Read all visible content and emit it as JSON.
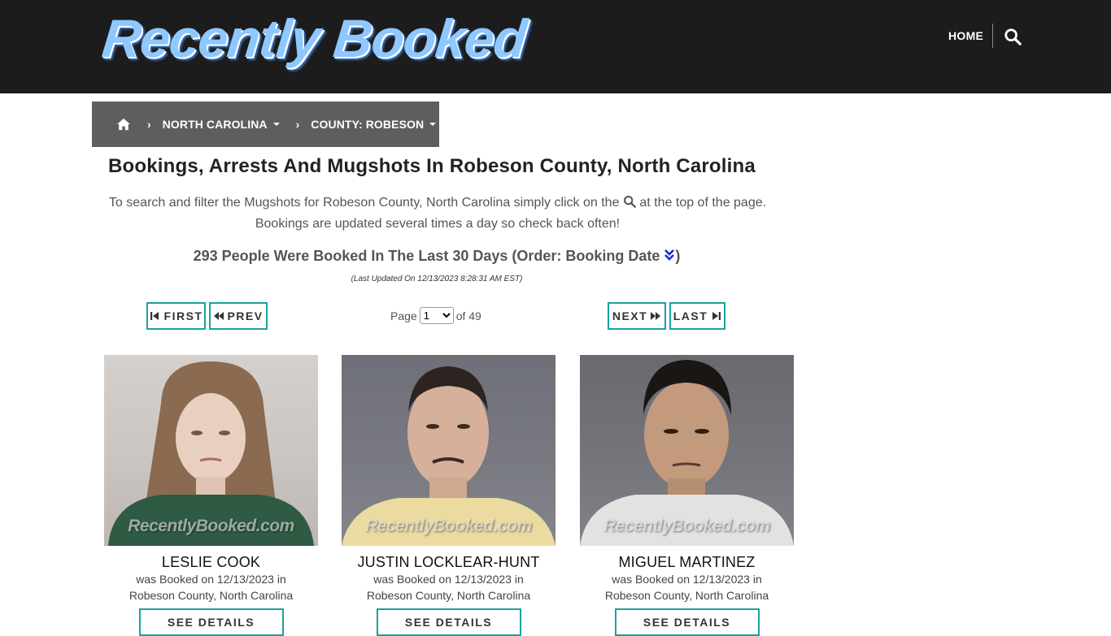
{
  "header": {
    "logo_text": "Recently Booked",
    "nav_home": "HOME",
    "search_icon": "search-icon"
  },
  "breadcrumb": {
    "home_icon": "home-icon",
    "state": "NORTH CAROLINA",
    "county": "COUNTY: ROBESON"
  },
  "main": {
    "title": "Bookings, Arrests And Mugshots In Robeson County, North Carolina",
    "intro_before": "To search and filter the Mugshots for Robeson County, North Carolina simply click on the",
    "intro_after": "at the top of the page. Bookings are updated several times a day so check back often!",
    "count_text": "293 People Were Booked In The Last 30 Days (Order: Booking Date",
    "count_close": ")",
    "last_updated": "(Last Updated On 12/13/2023 8:28:31 AM EST)"
  },
  "pagination": {
    "first": "FIRST",
    "prev": "PREV",
    "page_label": "Page",
    "current_page": "1",
    "of_label": "of 49",
    "next": "NEXT",
    "last": "LAST"
  },
  "bookings": [
    {
      "name": "LESLIE COOK",
      "line1": "was Booked on 12/13/2023 in",
      "line2": "Robeson County, North Carolina",
      "watermark": "RecentlyBooked.com",
      "details": "SEE DETAILS"
    },
    {
      "name": "JUSTIN LOCKLEAR-HUNT",
      "line1": "was Booked on 12/13/2023 in",
      "line2": "Robeson County, North Carolina",
      "watermark": "RecentlyBooked.com",
      "details": "SEE DETAILS"
    },
    {
      "name": "MIGUEL MARTINEZ",
      "line1": "was Booked on 12/13/2023 in",
      "line2": "Robeson County, North Carolina",
      "watermark": "RecentlyBooked.com",
      "details": "SEE DETAILS"
    }
  ],
  "colors": {
    "header_bg": "#1c1c1c",
    "breadcrumb_bg": "#5e5e5e",
    "accent": "#18a39d",
    "order_icon": "#1a2bd6"
  }
}
